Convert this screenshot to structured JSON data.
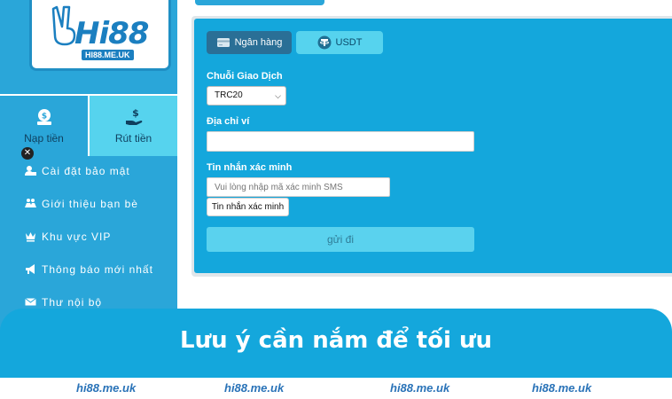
{
  "logo": {
    "brand": "Hi88",
    "url": "HI88.ME.UK"
  },
  "actions": {
    "deposit": "Nạp tiền",
    "withdraw": "Rút tiền"
  },
  "menu": [
    {
      "label": "Cài đặt bảo mật",
      "icon": "user-lock-icon"
    },
    {
      "label": "Giới thiệu bạn bè",
      "icon": "friends-icon"
    },
    {
      "label": "Khu vực VIP",
      "icon": "crown-icon"
    },
    {
      "label": "Thông báo mới nhất",
      "icon": "megaphone-icon"
    },
    {
      "label": "Thư nội bộ",
      "icon": "envelope-icon"
    }
  ],
  "close_badge": "✕",
  "tabs": {
    "bank": "Ngân hàng",
    "usdt": "USDT"
  },
  "form": {
    "chain_label": "Chuỗi Giao Dịch",
    "chain_value": "TRC20",
    "address_label": "Địa chỉ ví",
    "address_value": "",
    "sms_label": "Tin nhắn xác minh",
    "sms_placeholder": "Vui lòng nhập mã xác minh SMS",
    "sms_button": "Tin nhắn xác minh",
    "submit": "gửi đi"
  },
  "banner": {
    "title": "Lưu ý cần nắm để tối ưu"
  },
  "watermarks": [
    "hi88.me.uk",
    "hi88.me.uk",
    "hi88.me.uk",
    "hi88.me.uk"
  ],
  "colors": {
    "primary": "#14a7dc",
    "sidebar": "#2aa6d9",
    "accent": "#56d3ee",
    "tab_active": "#2a6f96"
  }
}
